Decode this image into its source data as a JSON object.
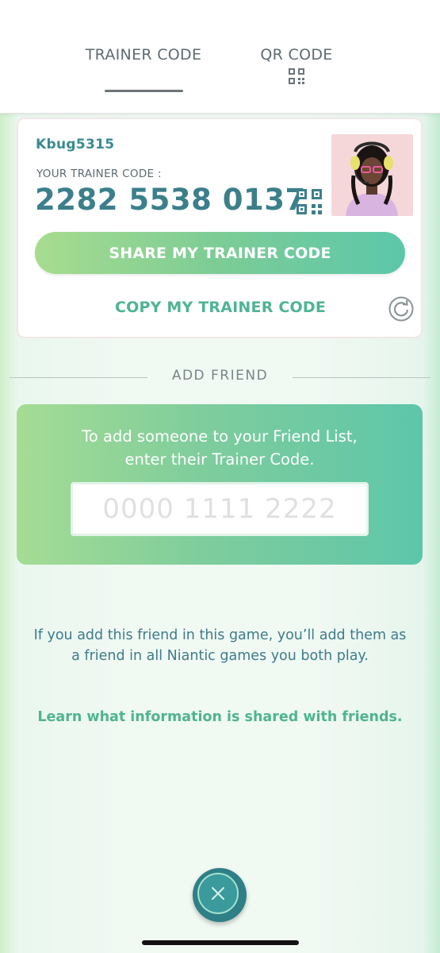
{
  "tabs": {
    "trainer_code": "TRAINER CODE",
    "qr_code": "QR CODE"
  },
  "profile": {
    "username": "Kbug5315",
    "code_label": "YOUR TRAINER CODE :",
    "trainer_code": "2282 5538 0137",
    "share_button": "SHARE MY TRAINER CODE",
    "copy_link": "COPY MY TRAINER CODE"
  },
  "add_friend": {
    "title": "ADD FRIEND",
    "instructions": "To add someone to your Friend List, enter their Trainer Code.",
    "input_value": "",
    "input_placeholder": "0000 1111 2222"
  },
  "footer": {
    "note": "If you add this friend in this game, you’ll add them as a friend in all Niantic games you both play.",
    "learn_link": "Learn what information is shared with friends."
  },
  "icons": {
    "qr": "qr-code-icon",
    "refresh": "refresh-icon",
    "close": "close-icon"
  },
  "colors": {
    "accent_teal": "#3c7f8b",
    "accent_green": "#4fb493",
    "close_button": "#2f7f86"
  }
}
